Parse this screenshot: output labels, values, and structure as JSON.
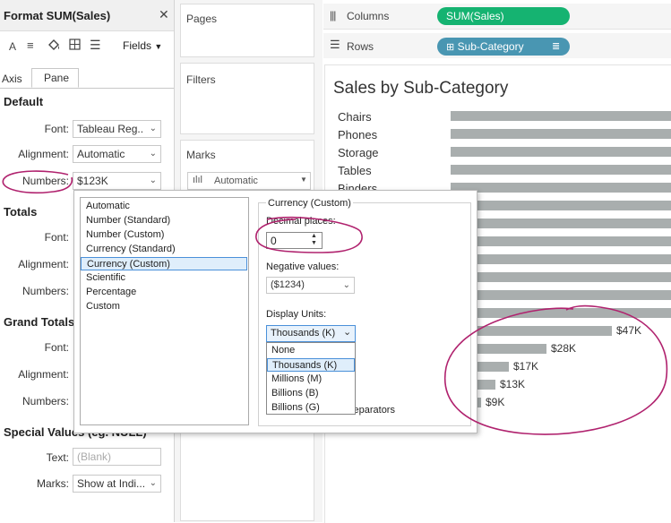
{
  "format_pane": {
    "title": "Format SUM(Sales)",
    "fields_label": "Fields",
    "tabs": [
      "Axis",
      "Pane"
    ],
    "default": {
      "heading": "Default",
      "font_label": "Font:",
      "font_value": "Tableau Reg..",
      "alignment_label": "Alignment:",
      "alignment_value": "Automatic",
      "numbers_label": "Numbers:",
      "numbers_value": "$123K"
    },
    "totals": {
      "heading": "Totals",
      "font_label": "Font:",
      "alignment_label": "Alignment:",
      "numbers_label": "Numbers:"
    },
    "grand_totals": {
      "heading": "Grand Totals",
      "font_label": "Font:",
      "alignment_label": "Alignment:",
      "numbers_label": "Numbers:"
    },
    "special_values": {
      "heading": "Special Values (eg. NULL)",
      "text_label": "Text:",
      "text_placeholder": "(Blank)",
      "marks_label": "Marks:",
      "marks_value": "Show at Indi..."
    }
  },
  "cards": {
    "pages": "Pages",
    "filters": "Filters",
    "marks": "Marks",
    "marks_type": "Automatic"
  },
  "shelves": {
    "columns_label": "Columns",
    "columns_pill": "SUM(Sales)",
    "rows_label": "Rows",
    "rows_pill": "Sub-Category"
  },
  "worksheet": {
    "title": "Sales by Sub-Category",
    "categories": [
      "Chairs",
      "Phones",
      "Storage",
      "Tables",
      "Binders"
    ]
  },
  "chart_data": {
    "type": "bar",
    "orientation": "horizontal",
    "visible_value_labels": [
      "$47K",
      "$28K",
      "$17K",
      "$13K",
      "$9K"
    ],
    "visible_values_thousands": [
      47,
      28,
      17,
      13,
      9
    ]
  },
  "number_format_popup": {
    "formats": [
      "Automatic",
      "Number (Standard)",
      "Number (Custom)",
      "Currency (Standard)",
      "Currency (Custom)",
      "Scientific",
      "Percentage",
      "Custom"
    ],
    "selected_format": "Currency (Custom)",
    "group_title": "Currency (Custom)",
    "decimal_label": "Decimal places:",
    "decimal_value": "0",
    "negative_label": "Negative values:",
    "negative_value": "($1234)",
    "display_units_label": "Display Units:",
    "display_units_value": "Thousands (K)",
    "display_units_options": [
      "None",
      "Thousands (K)",
      "Millions (M)",
      "Billions (B)",
      "Billions (G)"
    ],
    "separators_fragment": "ls separators"
  },
  "colors": {
    "columns_pill": "#15b371",
    "rows_pill": "#4996b2",
    "bar": "#a9aeae",
    "annotation": "#b0226e",
    "selection": "#dfeefb"
  }
}
